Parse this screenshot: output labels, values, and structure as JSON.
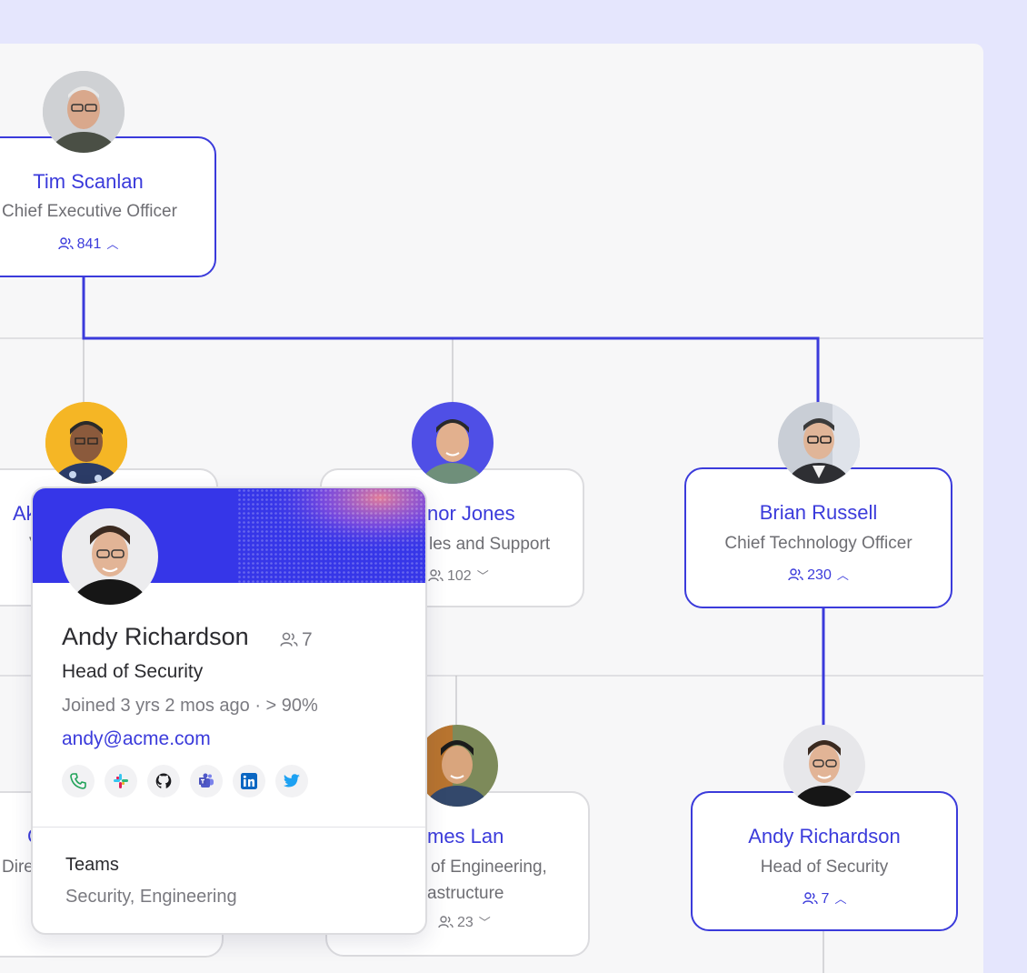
{
  "colors": {
    "accent": "#3b3bdb",
    "background": "#e5e6fd",
    "canvas": "#f7f7f8",
    "banner": "#3636e8"
  },
  "nodes": {
    "ceo": {
      "name": "Tim Scanlan",
      "title": "Chief Executive Officer",
      "count": "841"
    },
    "vp_left": {
      "name": "Ak",
      "title": "V"
    },
    "sales": {
      "name": "nor Jones",
      "title": "les and Support",
      "count": "102"
    },
    "cto": {
      "name": "Brian Russell",
      "title": "Chief Technology Officer",
      "count": "230"
    },
    "left_bottom": {
      "name": "C",
      "title": "Dire"
    },
    "james": {
      "name": "mes Lan",
      "title": "of Engineering,",
      "title2": "astructure",
      "count": "23"
    },
    "andy": {
      "name": "Andy Richardson",
      "title": "Head of Security",
      "count": "7"
    }
  },
  "popup": {
    "name": "Andy Richardson",
    "reports": "7",
    "title": "Head of Security",
    "joined": "Joined 3 yrs 2 mos ago · > 90%",
    "email": "andy@acme.com",
    "socials": [
      "phone-icon",
      "slack-icon",
      "github-icon",
      "teams-icon",
      "linkedin-icon",
      "twitter-icon"
    ],
    "teams_label": "Teams",
    "teams_value": "Security, Engineering"
  }
}
